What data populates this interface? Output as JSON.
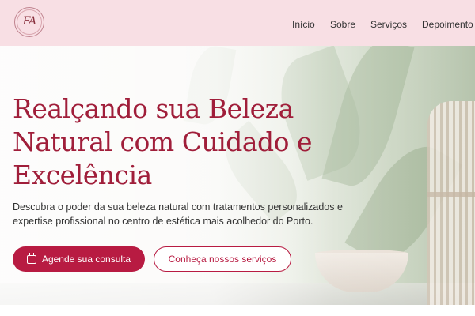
{
  "header": {
    "logo_text": "FA",
    "nav": [
      {
        "label": "Início"
      },
      {
        "label": "Sobre"
      },
      {
        "label": "Serviços"
      },
      {
        "label": "Depoimento"
      }
    ]
  },
  "hero": {
    "title_lines": [
      "Realçando sua Beleza",
      "Natural com Cuidado e",
      "Excelência"
    ],
    "description_lines": [
      "Descubra o poder da sua beleza natural com tratamentos personalizados e",
      "expertise profissional no centro de estética mais acolhedor do Porto."
    ],
    "primary_button": {
      "label": "Agende sua consulta",
      "icon": "calendar-icon"
    },
    "secondary_button": {
      "label": "Conheça nossos serviços"
    }
  },
  "colors": {
    "accent": "#b81b42",
    "title": "#a01e3a",
    "header_bg": "#f8dfe4"
  }
}
